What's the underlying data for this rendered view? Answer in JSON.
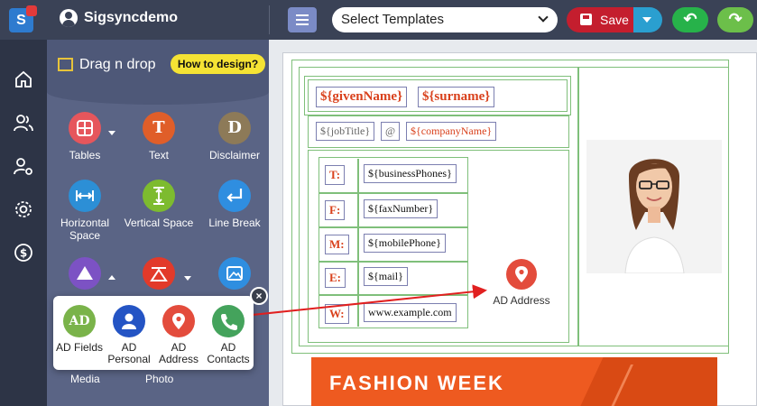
{
  "app": {
    "username": "Sigsyncdemo"
  },
  "toolbar": {
    "template_select": "Select Templates",
    "save_label": "Save"
  },
  "panel": {
    "title": "Drag n drop",
    "howto": "How to design?",
    "tools": [
      {
        "label": "Tables",
        "glyph": "",
        "color": "#e6565c"
      },
      {
        "label": "Text",
        "glyph": "T",
        "color": "#e05e29"
      },
      {
        "label": "Disclaimer",
        "glyph": "D",
        "color": "#8d7a58"
      },
      {
        "label": "Horizontal Space",
        "glyph": "",
        "color": "#2c8fd6"
      },
      {
        "label": "Vertical Space",
        "glyph": "",
        "color": "#7dbb2f"
      },
      {
        "label": "Line Break",
        "glyph": "",
        "color": "#2f8ee0"
      }
    ],
    "under_labels": {
      "media": "Media",
      "photo": "Photo"
    }
  },
  "popup": {
    "items": [
      {
        "label": "AD Fields",
        "glyph": "AD",
        "color": "#7ab34a"
      },
      {
        "label": "AD Personal",
        "color": "#2454c4"
      },
      {
        "label": "AD Address",
        "color": "#e34c3c"
      },
      {
        "label": "AD Contacts",
        "color": "#44a35c"
      }
    ]
  },
  "signature": {
    "given_name": "${givenName}",
    "surname": "${surname}",
    "job_title": "${jobTitle}",
    "at": "@",
    "company": "${companyName}",
    "rows": [
      {
        "label": "T:",
        "value": "${businessPhones}"
      },
      {
        "label": "F:",
        "value": "${faxNumber}"
      },
      {
        "label": "M:",
        "value": "${mobilePhone}"
      },
      {
        "label": "E:",
        "value": "${mail}"
      },
      {
        "label": "W:",
        "value": "www.example.com"
      }
    ],
    "dropped_label": "AD Address",
    "banner_text": "FASHION WEEK"
  }
}
